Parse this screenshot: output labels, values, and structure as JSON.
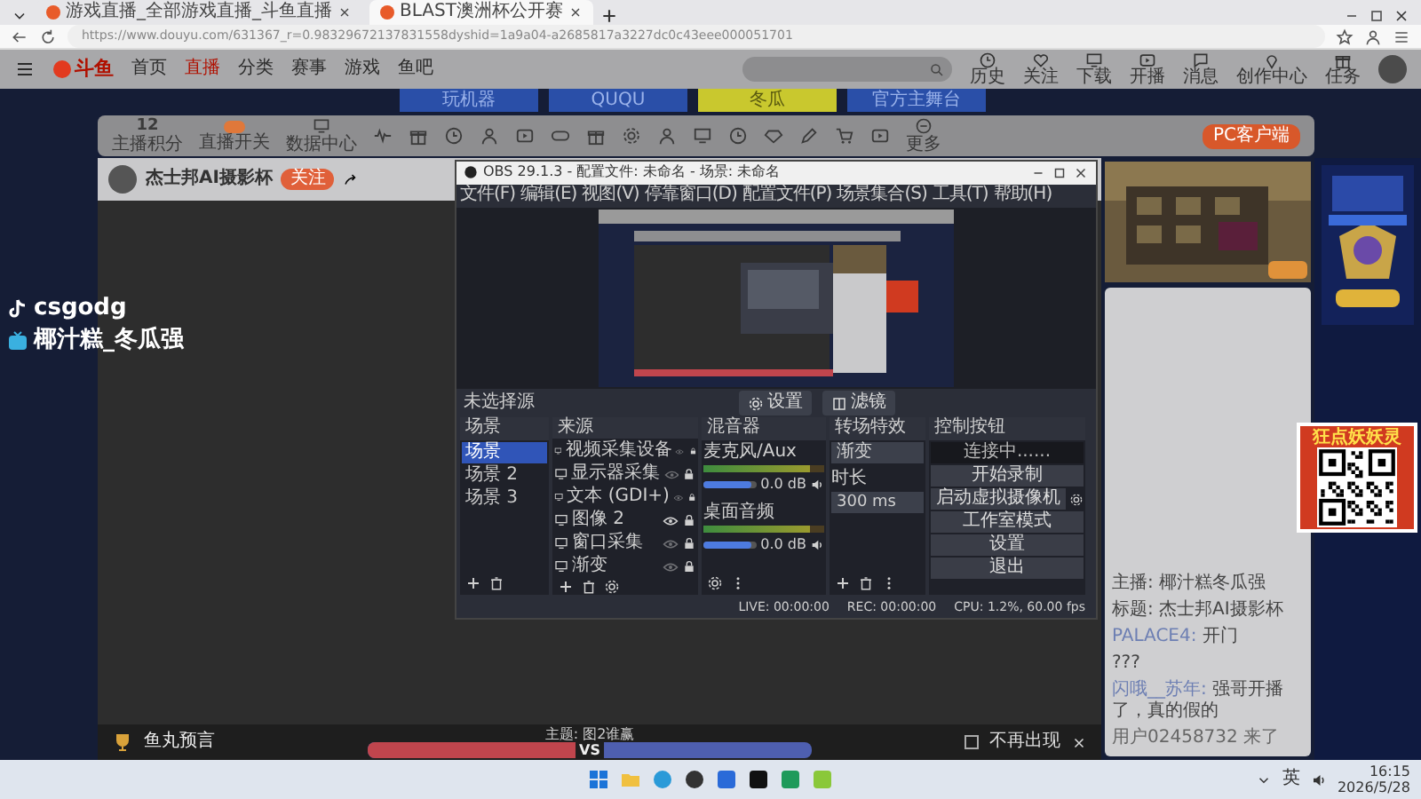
{
  "browser": {
    "tabs": [
      {
        "title": "游戏直播_全部游戏直播_斗鱼直播",
        "selected": false
      },
      {
        "title": "BLAST澳洲杯公开赛",
        "selected": true
      }
    ],
    "url": "https://www.douyu.com/631367_r=0.98329672137831558dyshid=1a9a04-a2685817a3227dc0c43eee000051701"
  },
  "site": {
    "logo": "斗鱼",
    "nav": [
      {
        "label": "首页",
        "selected": false
      },
      {
        "label": "直播",
        "selected": true
      },
      {
        "label": "分类",
        "selected": false
      },
      {
        "label": "赛事",
        "selected": false
      },
      {
        "label": "游戏",
        "selected": false
      },
      {
        "label": "鱼吧",
        "selected": false
      }
    ],
    "user_menu": [
      {
        "label": "历史",
        "kind": "clock"
      },
      {
        "label": "关注",
        "kind": "heart"
      },
      {
        "label": "下载",
        "kind": "monitor"
      },
      {
        "label": "开播",
        "kind": "play"
      },
      {
        "label": "消息",
        "kind": "chat"
      },
      {
        "label": "创作中心",
        "kind": "pin"
      },
      {
        "label": "任务",
        "kind": "gift"
      }
    ]
  },
  "banners": [
    {
      "label": "玩机器",
      "selected": false
    },
    {
      "label": "QUQU",
      "selected": false
    },
    {
      "label": "冬瓜",
      "selected": true
    },
    {
      "label": "官方主舞台",
      "selected": false
    }
  ],
  "toolbar": {
    "items": [
      {
        "kind": "score",
        "value": "12",
        "label": "主播积分"
      },
      {
        "kind": "toggle",
        "label": "直播开关"
      },
      {
        "kind": "monitor",
        "label": "数据中心"
      }
    ],
    "more": "更多",
    "client_button": "PC客户端"
  },
  "stream": {
    "title": "杰士邦AI摄影杯",
    "follow": "关注",
    "handles": [
      {
        "kind": "tiktok",
        "text": "csgodg"
      },
      {
        "kind": "bilibili",
        "text": "椰汁糕_冬瓜强"
      }
    ]
  },
  "obs": {
    "title": "OBS 29.1.3 - 配置文件: 未命名 - 场景: 未命名",
    "menu": [
      "文件(F)",
      "编辑(E)",
      "视图(V)",
      "停靠窗口(D)",
      "配置文件(P)",
      "场景集合(S)",
      "工具(T)",
      "帮助(H)"
    ],
    "no_source": "未选择源",
    "settings": "设置",
    "filters": "滤镜",
    "scenes": {
      "title": "场景",
      "items": [
        {
          "label": "场景",
          "selected": true
        },
        {
          "label": "场景 2",
          "selected": false
        },
        {
          "label": "场景 3",
          "selected": false
        }
      ]
    },
    "sources": {
      "title": "来源",
      "items": [
        {
          "label": "视频采集设备",
          "visible": false
        },
        {
          "label": "显示器采集",
          "visible": false
        },
        {
          "label": "文本 (GDI+)",
          "visible": false
        },
        {
          "label": "图像 2",
          "visible": true
        },
        {
          "label": "窗口采集",
          "visible": false
        },
        {
          "label": "渐变",
          "visible": false
        }
      ]
    },
    "mixer": {
      "title": "混音器",
      "channels": [
        {
          "name": "麦克风/Aux",
          "reading": "0.0 dB",
          "level": 0.88
        },
        {
          "name": "桌面音频",
          "reading": "0.0 dB",
          "level": 0.88
        }
      ]
    },
    "transitions": {
      "title": "转场特效",
      "type": "渐变",
      "duration_label": "时长",
      "duration": "300 ms"
    },
    "controls": {
      "title": "控制按钮",
      "status": "连接中......",
      "buttons": [
        "开始录制",
        "启动虚拟摄像机",
        "工作室模式",
        "设置",
        "退出"
      ]
    },
    "status": {
      "live": "LIVE: 00:00:00",
      "rec": "REC: 00:00:00",
      "cpu": "CPU: 1.2%, 60.00 fps"
    }
  },
  "chat": {
    "lines": [
      {
        "kind": "info",
        "text": "主播: 椰汁糕冬瓜强"
      },
      {
        "kind": "info",
        "text": "标题: 杰士邦AI摄影杯"
      },
      {
        "kind": "message",
        "user": "PALACE4:",
        "text": "开门"
      },
      {
        "kind": "message",
        "text": "???"
      },
      {
        "kind": "message",
        "user": "闪哦__苏年:",
        "text": "强哥开播了，真的假的"
      },
      {
        "kind": "enter",
        "text": "用户02458732 来了"
      }
    ]
  },
  "qr_ad": {
    "title": "狂点妖妖灵"
  },
  "prediction": {
    "title": "鱼丸预言",
    "topic": "主题: 图2谁赢",
    "vs": "VS",
    "level": 0.5,
    "dismiss": "不再出现",
    "dismiss_checked": false
  },
  "taskbar": {
    "ime": "英",
    "time": "16:15",
    "date": "2026/5/28"
  }
}
